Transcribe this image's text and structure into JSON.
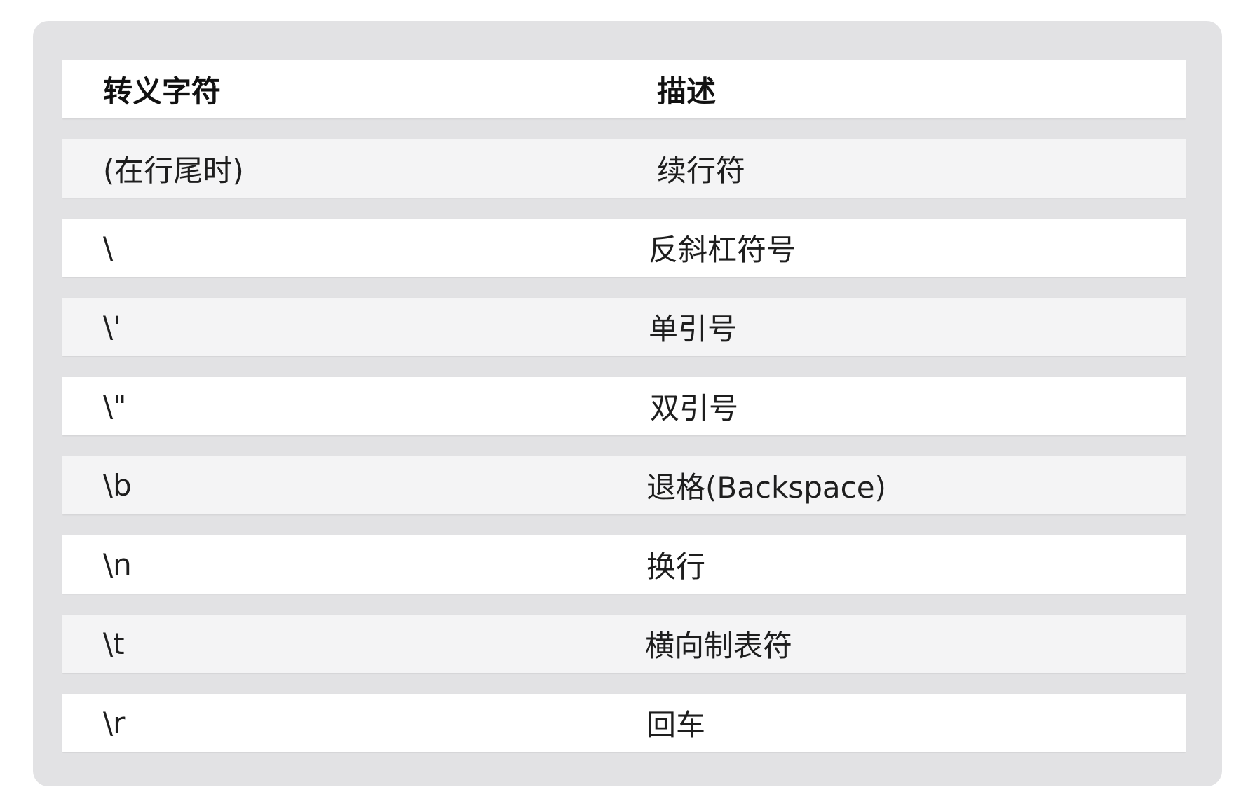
{
  "table": {
    "headers": {
      "escape_char": "转义字符",
      "description": "描述"
    },
    "rows": [
      {
        "code": "(在行尾时)",
        "description": "续行符"
      },
      {
        "code": "\\",
        "description": "反斜杠符号"
      },
      {
        "code": "\\'",
        "description": "单引号"
      },
      {
        "code": "\\\"",
        "description": "双引号"
      },
      {
        "code": "\\b",
        "description": "退格(Backspace)"
      },
      {
        "code": "\\n",
        "description": "换行"
      },
      {
        "code": "\\t",
        "description": "横向制表符"
      },
      {
        "code": "\\r",
        "description": "回车"
      }
    ]
  },
  "colors": {
    "panel_bg": "#e2e2e4",
    "row_light": "#ffffff",
    "row_shaded": "#f4f4f5",
    "text": "#1e1e1e"
  }
}
